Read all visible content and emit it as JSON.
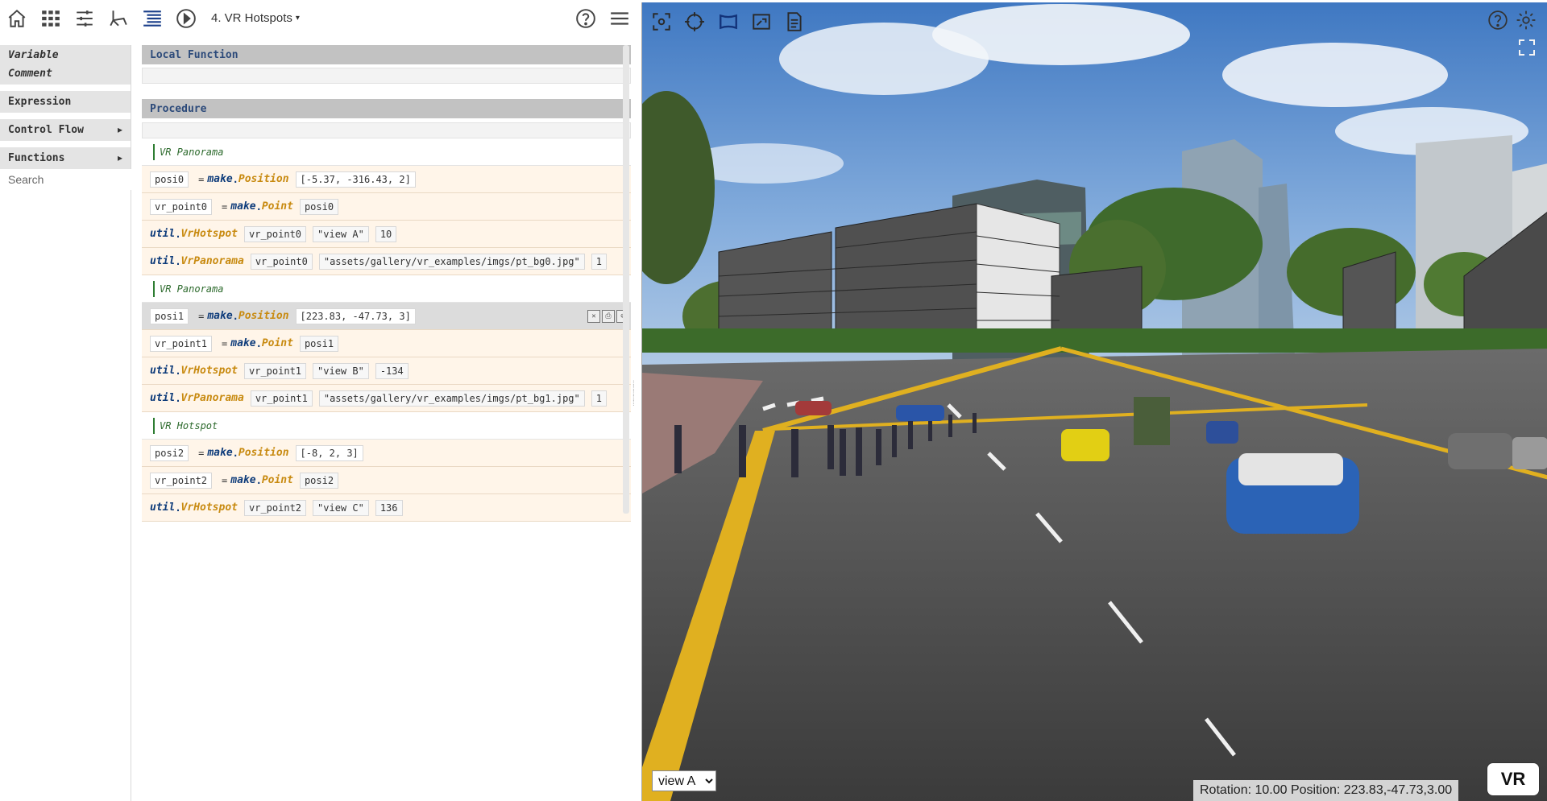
{
  "toolbar": {
    "flow_title": "4. VR Hotspots",
    "icons": [
      "home-icon",
      "dashboard-icon",
      "settings-sliders-icon",
      "flowchart-icon",
      "procedure-list-icon",
      "play-icon",
      "help-icon",
      "menu-icon"
    ]
  },
  "func_panel": {
    "variable": "Variable",
    "comment": "Comment",
    "expression": "Expression",
    "control_flow": "Control Flow",
    "functions": "Functions",
    "arrow": "▶",
    "search_placeholder": "Search"
  },
  "editor": {
    "local_function": "Local Function",
    "procedure": "Procedure",
    "comments": {
      "c0": "VR Panorama",
      "c1": "VR Panorama",
      "c2": "VR Hotspot"
    },
    "rows": {
      "r0": {
        "var": "posi0",
        "eq": "=",
        "mod": "make",
        "fn": "Position",
        "arg": "[-5.37, -316.43, 2]"
      },
      "r1": {
        "var": "vr_point0",
        "eq": "=",
        "mod": "make",
        "fn": "Point",
        "arg": "posi0"
      },
      "r2": {
        "mod": "util",
        "fn": "VrHotspot",
        "a1": "vr_point0",
        "a2": "\"view A\"",
        "a3": "10"
      },
      "r3": {
        "mod": "util",
        "fn": "VrPanorama",
        "a1": "vr_point0",
        "a2": "\"assets/gallery/vr_examples/imgs/pt_bg0.jpg\"",
        "a3": "1"
      },
      "r4": {
        "var": "posi1",
        "eq": "=",
        "mod": "make",
        "fn": "Position",
        "arg": "[223.83, -47.73, 3]"
      },
      "r5": {
        "var": "vr_point1",
        "eq": "=",
        "mod": "make",
        "fn": "Point",
        "arg": "posi1"
      },
      "r6": {
        "mod": "util",
        "fn": "VrHotspot",
        "a1": "vr_point1",
        "a2": "\"view B\"",
        "a3": "-134"
      },
      "r7": {
        "mod": "util",
        "fn": "VrPanorama",
        "a1": "vr_point1",
        "a2": "\"assets/gallery/vr_examples/imgs/pt_bg1.jpg\"",
        "a3": "1"
      },
      "r8": {
        "var": "posi2",
        "eq": "=",
        "mod": "make",
        "fn": "Position",
        "arg": "[-8, 2, 3]"
      },
      "r9": {
        "var": "vr_point2",
        "eq": "=",
        "mod": "make",
        "fn": "Point",
        "arg": "posi2"
      },
      "r10": {
        "mod": "util",
        "fn": "VrHotspot",
        "a1": "vr_point2",
        "a2": "\"view C\"",
        "a3": "136"
      }
    }
  },
  "viewer": {
    "view_selected": "view A",
    "readout": "Rotation: 10.00 Position: 223.83,-47.73,3.00",
    "vr_button": "VR",
    "icons": [
      "zoom-fit-icon",
      "crosshair-icon",
      "frame-icon",
      "picture-frame-icon",
      "document-icon",
      "help-icon",
      "settings-gear-icon",
      "fullscreen-icon"
    ]
  },
  "colors": {
    "accent_blue": "#0d3b7a",
    "function_gold": "#c88a10",
    "comment_green": "#2e7d32",
    "row_bg": "#fff5e9"
  }
}
